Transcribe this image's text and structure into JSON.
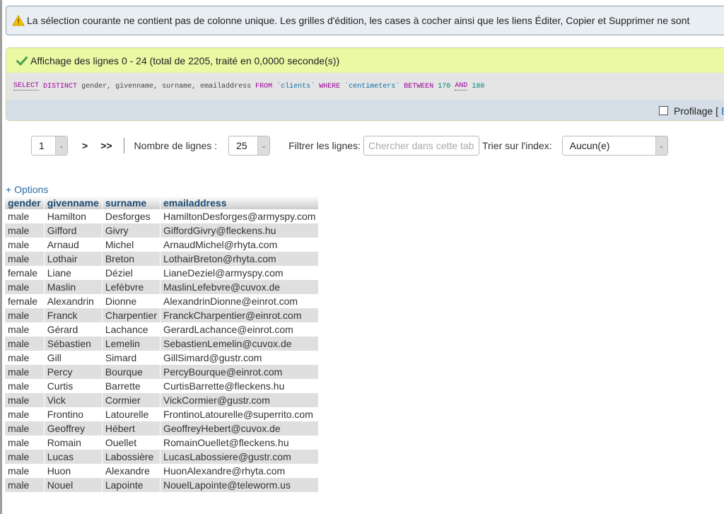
{
  "notice": {
    "icon": "warning-icon",
    "text": "La sélection courante ne contient pas de colonne unique. Les grilles d'édition, les cases à cocher ainsi que les liens Éditer, Copier et Supprimer ne sont"
  },
  "result": {
    "icon": "check-icon",
    "message": "Affichage des lignes 0 - 24 (total de 2205, traité en 0,0000 seconde(s))",
    "sql": {
      "select": "SELECT",
      "distinct": "DISTINCT",
      "columns": "gender, givenname, surname, emailaddress",
      "from": "FROM",
      "table": "`clients`",
      "where": "WHERE",
      "column": "`centimeters`",
      "between": "BETWEEN",
      "low": "170",
      "and": "AND",
      "high": "180"
    },
    "profiling_label": "Profilage [",
    "edit_link": "Éd"
  },
  "navigation": {
    "page_value": "1",
    "next_label": ">",
    "last_label": ">>",
    "rows_label": "Nombre de lignes :",
    "rows_value": "25",
    "filter_label": "Filtrer les lignes:",
    "filter_placeholder": "Chercher dans cette table",
    "sort_label": "Trier sur l'index:",
    "sort_value": "Aucun(e)"
  },
  "options_label": "+ Options",
  "table": {
    "columns": [
      "gender",
      "givenname",
      "surname",
      "emailaddress"
    ],
    "rows": [
      [
        "male",
        "Hamilton",
        "Desforges",
        "HamiltonDesforges@armyspy.com"
      ],
      [
        "male",
        "Gifford",
        "Givry",
        "GiffordGivry@fleckens.hu"
      ],
      [
        "male",
        "Arnaud",
        "Michel",
        "ArnaudMichel@rhyta.com"
      ],
      [
        "male",
        "Lothair",
        "Breton",
        "LothairBreton@rhyta.com"
      ],
      [
        "female",
        "Liane",
        "Déziel",
        "LianeDeziel@armyspy.com"
      ],
      [
        "male",
        "Maslin",
        "Lefèbvre",
        "MaslinLefebvre@cuvox.de"
      ],
      [
        "female",
        "Alexandrin",
        "Dionne",
        "AlexandrinDionne@einrot.com"
      ],
      [
        "male",
        "Franck",
        "Charpentier",
        "FranckCharpentier@einrot.com"
      ],
      [
        "male",
        "Gérard",
        "Lachance",
        "GerardLachance@einrot.com"
      ],
      [
        "male",
        "Sébastien",
        "Lemelin",
        "SebastienLemelin@cuvox.de"
      ],
      [
        "male",
        "Gill",
        "Simard",
        "GillSimard@gustr.com"
      ],
      [
        "male",
        "Percy",
        "Bourque",
        "PercyBourque@einrot.com"
      ],
      [
        "male",
        "Curtis",
        "Barrette",
        "CurtisBarrette@fleckens.hu"
      ],
      [
        "male",
        "Vick",
        "Cormier",
        "VickCormier@gustr.com"
      ],
      [
        "male",
        "Frontino",
        "Latourelle",
        "FrontinoLatourelle@superrito.com"
      ],
      [
        "male",
        "Geoffrey",
        "Hébert",
        "GeoffreyHebert@cuvox.de"
      ],
      [
        "male",
        "Romain",
        "Ouellet",
        "RomainOuellet@fleckens.hu"
      ],
      [
        "male",
        "Lucas",
        "Labossière",
        "LucasLabossiere@gustr.com"
      ],
      [
        "male",
        "Huon",
        "Alexandre",
        "HuonAlexandre@rhyta.com"
      ],
      [
        "male",
        "Nouel",
        "Lapointe",
        "NouelLapointe@teleworm.us"
      ]
    ]
  }
}
